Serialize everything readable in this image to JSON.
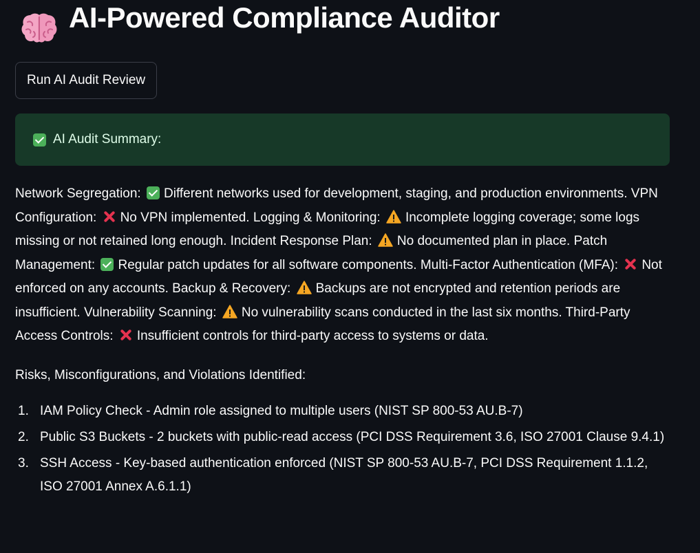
{
  "app": {
    "title": "AI-Powered Compliance Auditor",
    "title_icon": "brain-icon"
  },
  "actions": {
    "run_label": "Run AI Audit Review"
  },
  "summary": {
    "label": "AI Audit Summary:",
    "icon": "check-mark-icon",
    "color": "#173928"
  },
  "findings": [
    {
      "name": "Network Segregation:",
      "status": "pass",
      "text": "Different networks used for development, staging, and production environments."
    },
    {
      "name": "VPN Configuration:",
      "status": "fail",
      "text": "No VPN implemented."
    },
    {
      "name": "Logging & Monitoring:",
      "status": "warn",
      "text": "Incomplete logging coverage; some logs missing or not retained long enough."
    },
    {
      "name": "Incident Response Plan:",
      "status": "warn",
      "text": "No documented plan in place."
    },
    {
      "name": "Patch Management:",
      "status": "pass",
      "text": "Regular patch updates for all software components."
    },
    {
      "name": "Multi-Factor Authentication (MFA):",
      "status": "fail",
      "text": "Not enforced on any accounts."
    },
    {
      "name": "Backup & Recovery:",
      "status": "warn",
      "text": "Backups are not encrypted and retention periods are insufficient."
    },
    {
      "name": "Vulnerability Scanning:",
      "status": "warn",
      "text": "No vulnerability scans conducted in the last six months."
    },
    {
      "name": "Third-Party Access Controls:",
      "status": "fail",
      "text": "Insufficient controls for third-party access to systems or data."
    }
  ],
  "risks": {
    "heading": "Risks, Misconfigurations, and Violations Identified:",
    "items": [
      {
        "number": "1.",
        "text": "IAM Policy Check - Admin role assigned to multiple users (NIST SP 800-53 AU.B-7)"
      },
      {
        "number": "2.",
        "text": "Public S3 Buckets - 2 buckets with public-read access (PCI DSS Requirement 3.6, ISO 27001 Clause 9.4.1)"
      },
      {
        "number": "3.",
        "text": "SSH Access - Key-based authentication enforced (NIST SP 800-53 AU.B-7, PCI DSS Requirement 1.1.2, ISO 27001 Annex A.6.1.1)"
      }
    ]
  },
  "colors": {
    "background": "#0e1117",
    "pass": "#4cb05a",
    "fail": "#e4324f",
    "warn": "#f5a623"
  }
}
